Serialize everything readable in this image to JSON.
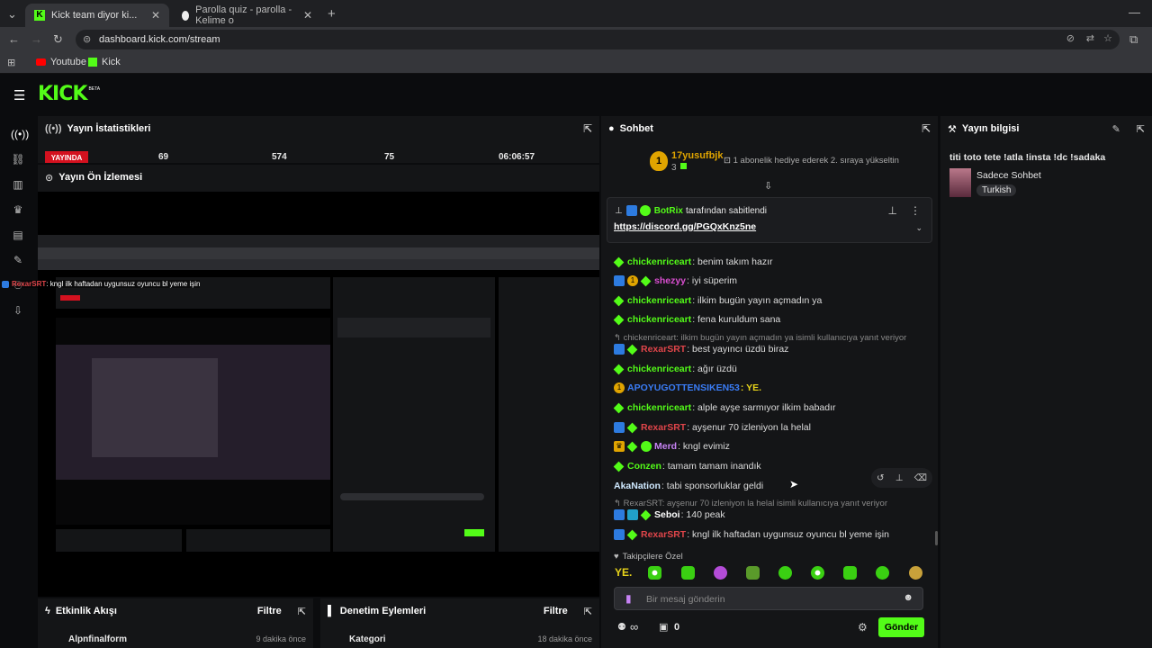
{
  "browser": {
    "tabs": [
      {
        "title": "Kick team diyor ki..."
      },
      {
        "title": "Parolla quiz - parolla - Kelime o"
      }
    ],
    "url": "dashboard.kick.com/stream",
    "bookmarks": [
      "Youtube",
      "Kick"
    ]
  },
  "app": {
    "logo": "KICK",
    "logo_beta": "BETA"
  },
  "stats": {
    "title": "Yayın İstatistikleri",
    "live": "YAYINDA",
    "values": [
      "69",
      "574",
      "75",
      "06:06:57"
    ]
  },
  "preview": {
    "title": "Yayın Ön İzlemesi",
    "overlay_user": "RexarSRT",
    "overlay_text": ": kngl ilk haftadan uygunsuz oyuncu bl yeme işin"
  },
  "activity": {
    "title": "Etkinlik Akışı",
    "filter": "Filtre",
    "row_name": "Alpnfinalform",
    "row_time": "9 dakika önce"
  },
  "moderation": {
    "title": "Denetim Eylemleri",
    "filter": "Filtre",
    "row_name": "Kategori",
    "row_time": "18 dakika önce"
  },
  "chat": {
    "title": "Sohbet",
    "top_user": "17yusufbjk",
    "top_count": "3",
    "top_msg": "1 abonelik hediye ederek 2. sıraya yükseltin",
    "pinned_by": "BotRix",
    "pinned_by_suffix": "tarafından sabitlendi",
    "pinned_link": "https://discord.gg/PGQxKnz5ne",
    "messages": [
      {
        "user": "chickenriceart",
        "color": "#53fc18",
        "text": ": benim takım hazır"
      },
      {
        "user": "shezyy",
        "color": "#d94ed0",
        "text": ": iyi süperim"
      },
      {
        "user": "chickenriceart",
        "color": "#53fc18",
        "text": ": ilkim bugün yayın açmadın ya"
      },
      {
        "user": "chickenriceart",
        "color": "#53fc18",
        "text": ": fena kuruldum sana"
      },
      {
        "user": "RexarSRT",
        "color": "#e0454a",
        "text": ": best yayıncı üzdü biraz"
      },
      {
        "user": "chickenriceart",
        "color": "#53fc18",
        "text": ": ağır üzdü"
      },
      {
        "user": "APOYUGOTTENSIKEN53",
        "color": "#3a7cf5",
        "text": ": YE."
      },
      {
        "user": "chickenriceart",
        "color": "#53fc18",
        "text": ": alple ayşe sarmıyor ilkim babadır"
      },
      {
        "user": "RexarSRT",
        "color": "#e0454a",
        "text": ": ayşenur 70 izleniyon la helal"
      },
      {
        "user": "Merd",
        "color": "#c783f5",
        "text": ": kngl evimiz"
      },
      {
        "user": "Conzen",
        "color": "#53fc18",
        "text": ": tamam tamam inandık"
      },
      {
        "user": "AkaNation",
        "color": "#cfe9ff",
        "text": ": tabi sponsorluklar geldi"
      },
      {
        "user": "Seboi",
        "color": "#ffffff",
        "text": ": 140 peak"
      },
      {
        "user": "RexarSRT",
        "color": "#e0454a",
        "text": ": kngl ilk haftadan uygunsuz oyuncu bl yeme işin"
      }
    ],
    "reply1": "chickenriceart: ilkim bugün yayın açmadın ya isimli kullanıcıya yanıt veriyor",
    "reply2": "RexarSRT: ayşenur 70 izleniyon la helal isimli kullanıcıya yanıt veriyor",
    "followers_label": "Takipçilere Özel",
    "input_placeholder": "Bir mesaj gönderin",
    "count_left": "∞",
    "count_right": "0",
    "send": "Gönder"
  },
  "info": {
    "title": "Yayın bilgisi",
    "stream_title": "titi toto tete !atla !insta !dc !sadaka",
    "category": "Sadece Sohbet",
    "language": "Turkish"
  }
}
